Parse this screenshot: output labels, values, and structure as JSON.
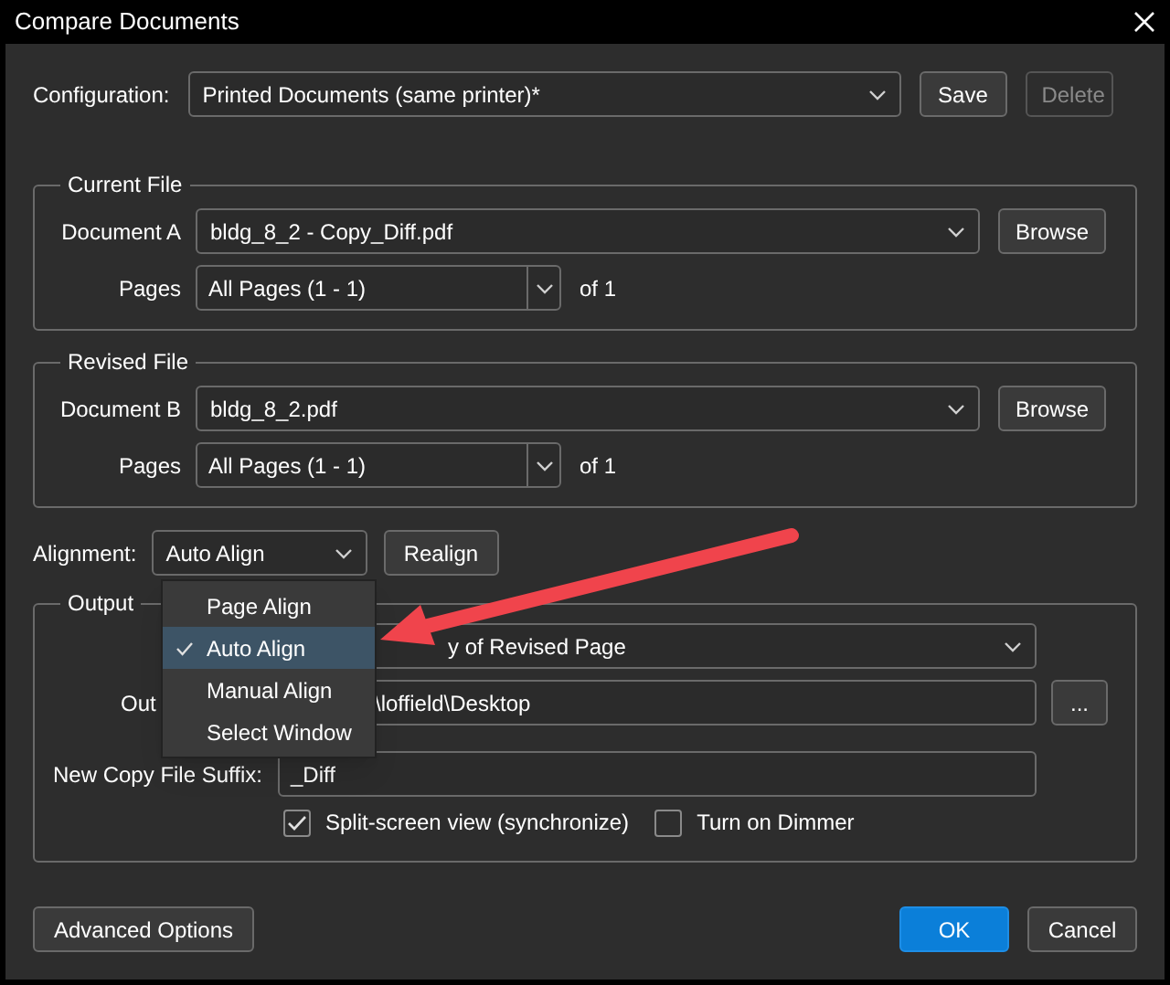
{
  "window": {
    "title": "Compare Documents"
  },
  "configuration": {
    "label": "Configuration:",
    "value": "Printed Documents (same printer)*",
    "buttons": [
      {
        "label": "Save",
        "disabled": false
      },
      {
        "label": "Delete",
        "disabled": true
      }
    ]
  },
  "files": [
    {
      "title": "Current File",
      "document_label": "Document A",
      "document": "bldg_8_2 - Copy_Diff.pdf",
      "browse": "Browse",
      "pages_label": "Pages",
      "pages": "All Pages (1 - 1)",
      "page_count": "of 1"
    },
    {
      "title": "Revised File",
      "document_label": "Document B",
      "document": "bldg_8_2.pdf",
      "browse": "Browse",
      "pages_label": "Pages",
      "pages": "All Pages (1 - 1)",
      "page_count": "of 1"
    }
  ],
  "alignment": {
    "label": "Alignment:",
    "value": "Auto Align",
    "realign": "Realign",
    "menu": [
      {
        "label": "Page Align",
        "selected": false
      },
      {
        "label": "Auto Align",
        "selected": true
      },
      {
        "label": "Manual Align",
        "selected": false
      },
      {
        "label": "Select Window",
        "selected": false
      }
    ]
  },
  "output": {
    "title": "Output",
    "mode_value": "y of Revised Page",
    "folder_label": "Out",
    "folder_value": "\\loffield\\Desktop",
    "browse": "...",
    "suffix_label": "New Copy File Suffix:",
    "suffix_value": "_Diff",
    "options": [
      {
        "label": "Split-screen view (synchronize)",
        "checked": true
      },
      {
        "label": "Turn on Dimmer",
        "checked": false
      }
    ]
  },
  "footer": {
    "advanced": "Advanced Options",
    "ok": "OK",
    "cancel": "Cancel"
  }
}
